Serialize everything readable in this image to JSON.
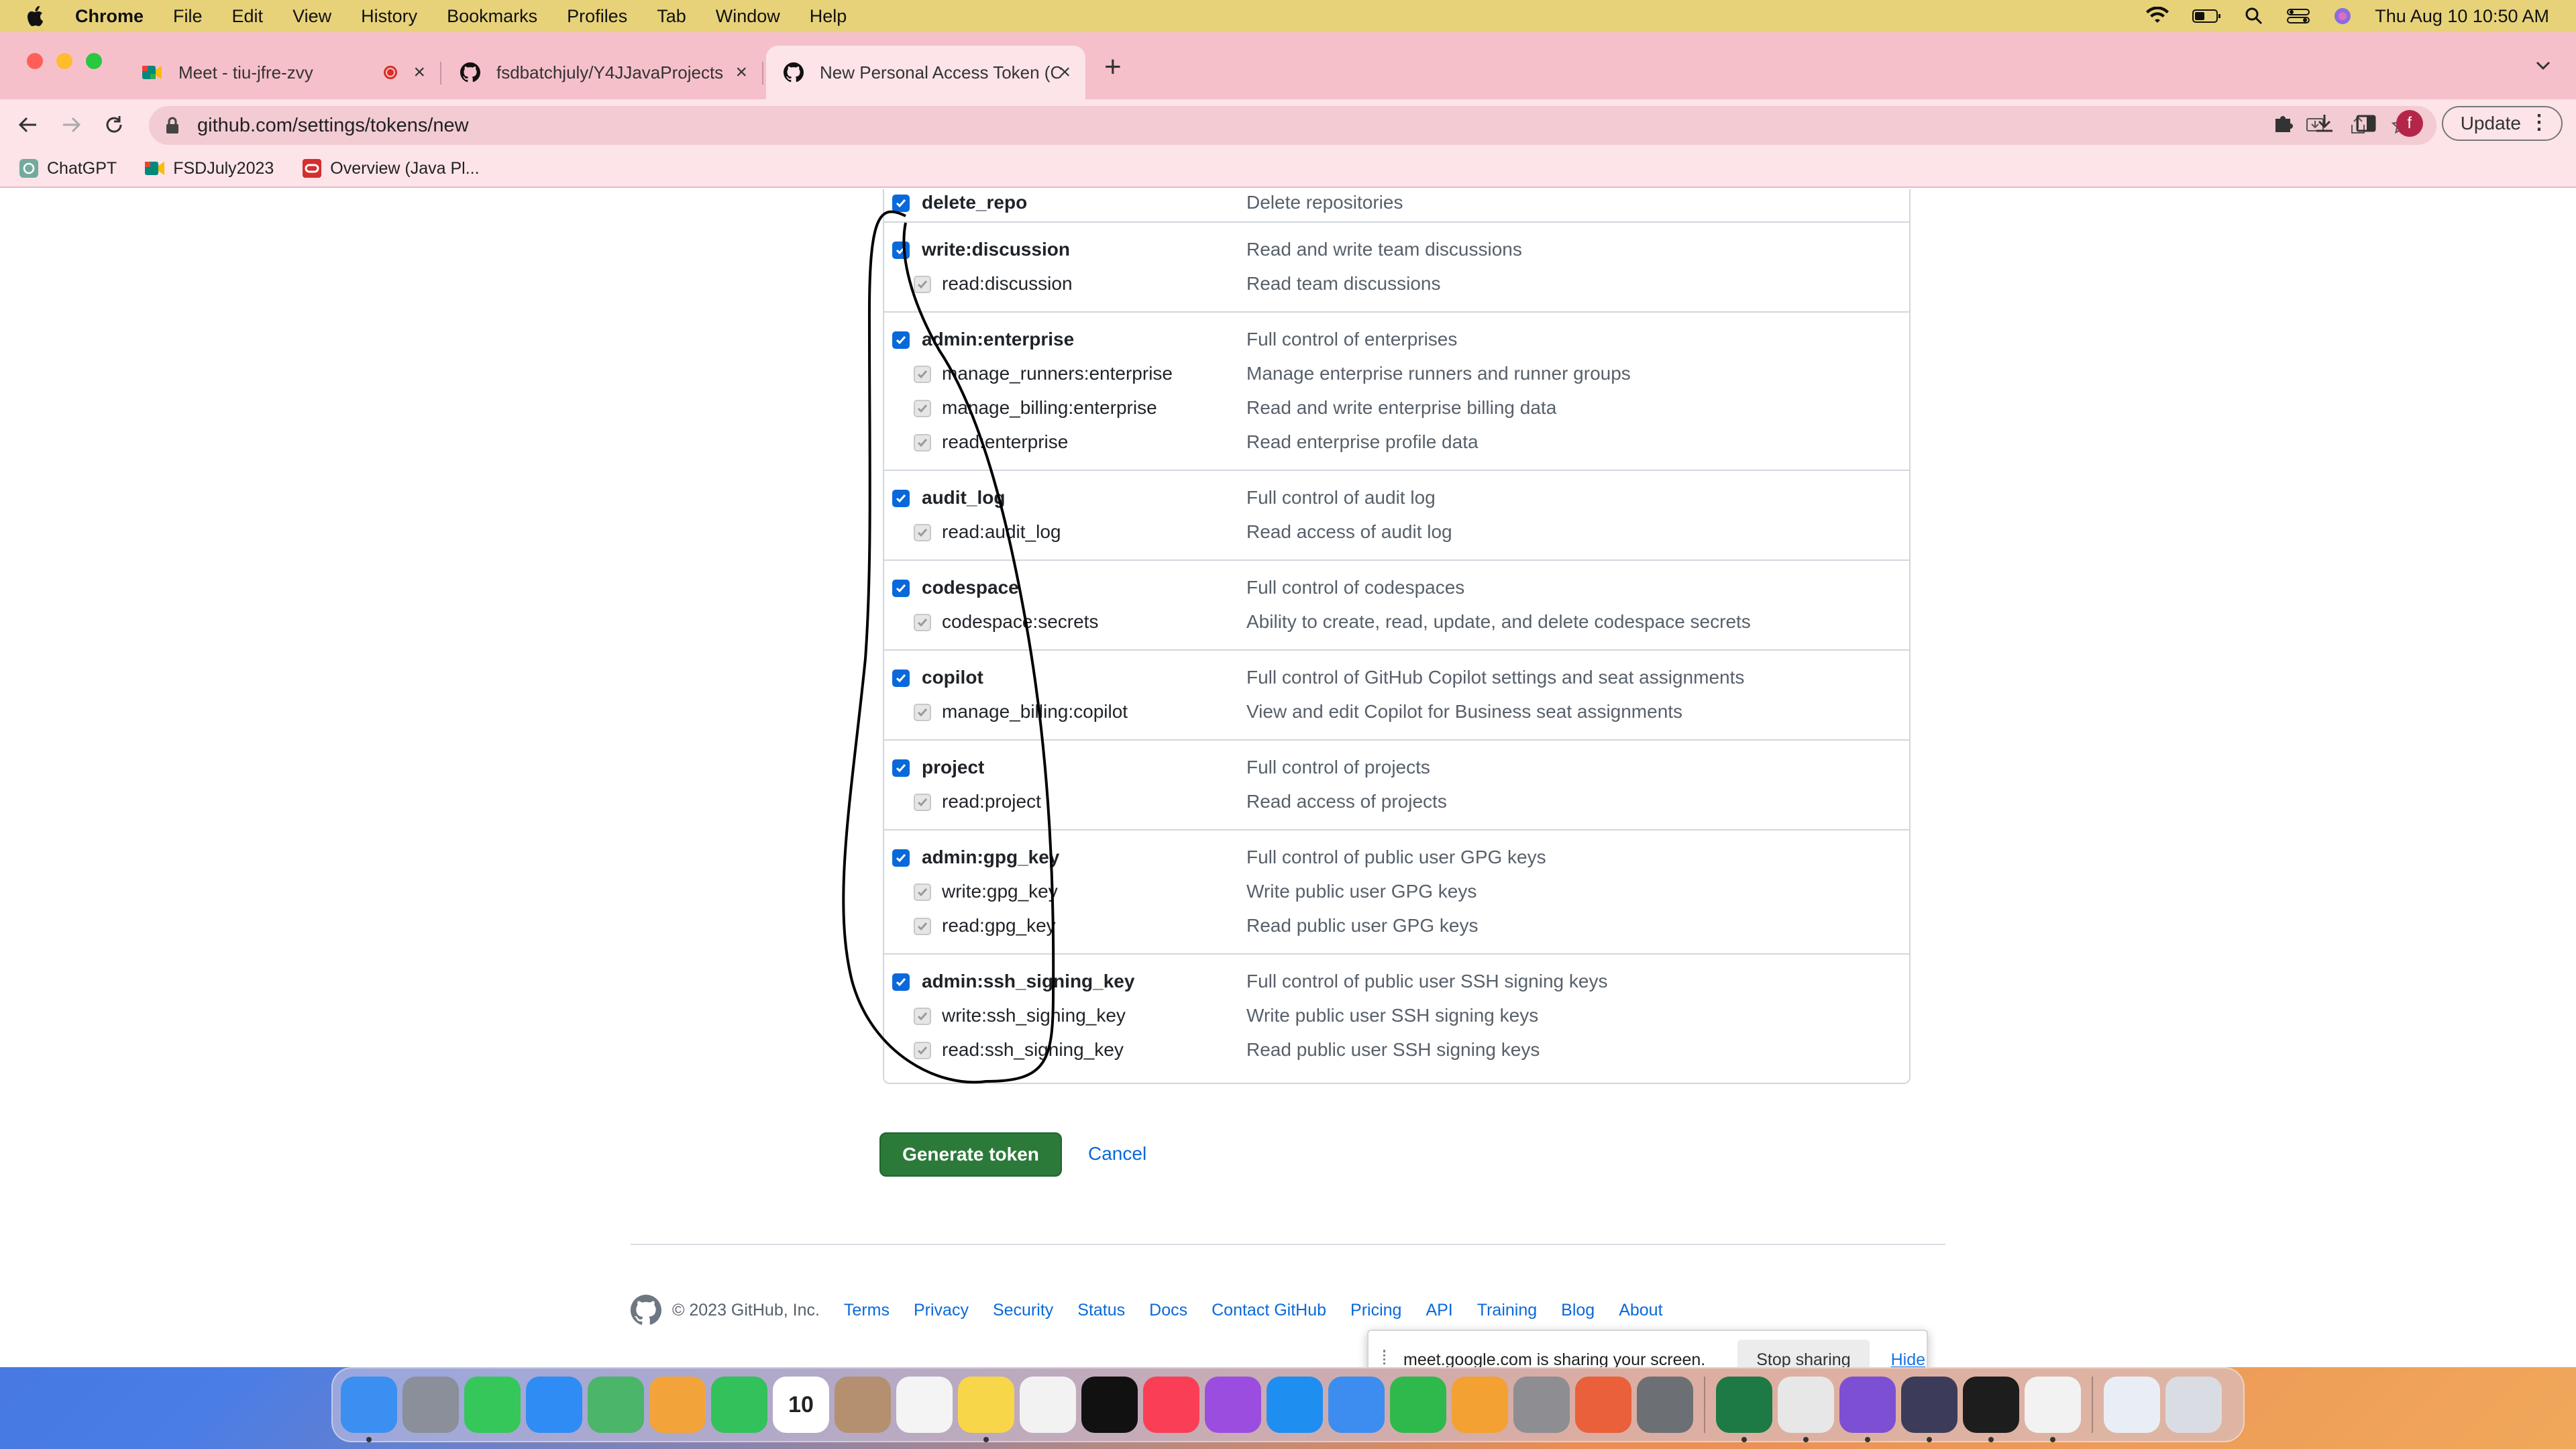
{
  "menubar": {
    "items": [
      "Chrome",
      "File",
      "Edit",
      "View",
      "History",
      "Bookmarks",
      "Profiles",
      "Tab",
      "Window",
      "Help"
    ],
    "datetime": "Thu Aug 10  10:50 AM"
  },
  "tabs": [
    {
      "title": "Meet - tiu-jfre-zvy"
    },
    {
      "title": "fsdbatchjuly/Y4JJavaProjects"
    },
    {
      "title": "New Personal Access Token (C"
    }
  ],
  "address": {
    "url": "github.com/settings/tokens/new"
  },
  "toolbar": {
    "update_label": "Update",
    "avatar_letter": "f"
  },
  "bookmarks": [
    {
      "label": "ChatGPT"
    },
    {
      "label": "FSDJuly2023"
    },
    {
      "label": "Overview (Java Pl..."
    }
  ],
  "scopes": [
    {
      "rows": [
        {
          "name": "delete_repo",
          "desc": "Delete repositories"
        }
      ]
    },
    {
      "rows": [
        {
          "name": "write:discussion",
          "desc": "Read and write team discussions"
        },
        {
          "name": "read:discussion",
          "desc": "Read team discussions",
          "sub": true
        }
      ]
    },
    {
      "rows": [
        {
          "name": "admin:enterprise",
          "desc": "Full control of enterprises"
        },
        {
          "name": "manage_runners:enterprise",
          "desc": "Manage enterprise runners and runner groups",
          "sub": true
        },
        {
          "name": "manage_billing:enterprise",
          "desc": "Read and write enterprise billing data",
          "sub": true
        },
        {
          "name": "read:enterprise",
          "desc": "Read enterprise profile data",
          "sub": true
        }
      ]
    },
    {
      "rows": [
        {
          "name": "audit_log",
          "desc": "Full control of audit log"
        },
        {
          "name": "read:audit_log",
          "desc": "Read access of audit log",
          "sub": true
        }
      ]
    },
    {
      "rows": [
        {
          "name": "codespace",
          "desc": "Full control of codespaces"
        },
        {
          "name": "codespace:secrets",
          "desc": "Ability to create, read, update, and delete codespace secrets",
          "sub": true
        }
      ]
    },
    {
      "rows": [
        {
          "name": "copilot",
          "desc": "Full control of GitHub Copilot settings and seat assignments"
        },
        {
          "name": "manage_billing:copilot",
          "desc": "View and edit Copilot for Business seat assignments",
          "sub": true
        }
      ]
    },
    {
      "rows": [
        {
          "name": "project",
          "desc": "Full control of projects"
        },
        {
          "name": "read:project",
          "desc": "Read access of projects",
          "sub": true
        }
      ]
    },
    {
      "rows": [
        {
          "name": "admin:gpg_key",
          "desc": "Full control of public user GPG keys"
        },
        {
          "name": "write:gpg_key",
          "desc": "Write public user GPG keys",
          "sub": true
        },
        {
          "name": "read:gpg_key",
          "desc": "Read public user GPG keys",
          "sub": true
        }
      ]
    },
    {
      "rows": [
        {
          "name": "admin:ssh_signing_key",
          "desc": "Full control of public user SSH signing keys"
        },
        {
          "name": "write:ssh_signing_key",
          "desc": "Write public user SSH signing keys",
          "sub": true
        },
        {
          "name": "read:ssh_signing_key",
          "desc": "Read public user SSH signing keys",
          "sub": true
        }
      ]
    }
  ],
  "actions": {
    "generate": "Generate token",
    "cancel": "Cancel"
  },
  "footer": {
    "copyright": "© 2023 GitHub, Inc.",
    "links": [
      "Terms",
      "Privacy",
      "Security",
      "Status",
      "Docs",
      "Contact GitHub",
      "Pricing",
      "API",
      "Training",
      "Blog",
      "About"
    ]
  },
  "sharebar": {
    "text": "meet.google.com is sharing your screen.",
    "stop": "Stop sharing",
    "hide": "Hide"
  },
  "dock": {
    "apps": [
      {
        "name": "finder",
        "color": "#3b8ff0",
        "running": true
      },
      {
        "name": "launchpad",
        "color": "#8a8f99"
      },
      {
        "name": "messages",
        "color": "#35c759"
      },
      {
        "name": "mail",
        "color": "#2f8cf4"
      },
      {
        "name": "maps",
        "color": "#4bb56a"
      },
      {
        "name": "photos",
        "color": "#f2a43a"
      },
      {
        "name": "facetime",
        "color": "#32c15a"
      },
      {
        "name": "calendar",
        "color": "#ffffff",
        "label": "10"
      },
      {
        "name": "contacts",
        "color": "#b49070"
      },
      {
        "name": "reminders",
        "color": "#f4f4f4"
      },
      {
        "name": "notes",
        "color": "#f7d64a",
        "running": true
      },
      {
        "name": "freeform",
        "color": "#f2f2f2"
      },
      {
        "name": "tv",
        "color": "#111111"
      },
      {
        "name": "music",
        "color": "#fa3e55"
      },
      {
        "name": "podcasts",
        "color": "#9b4de0"
      },
      {
        "name": "app-store",
        "color": "#1f8ef1"
      },
      {
        "name": "keynote",
        "color": "#3d8df0"
      },
      {
        "name": "numbers",
        "color": "#2fb94d"
      },
      {
        "name": "pages",
        "color": "#f3a132"
      },
      {
        "name": "system-settings",
        "color": "#8d8d92"
      },
      {
        "name": "firefox",
        "color": "#e9603a"
      },
      {
        "name": "image-capture",
        "color": "#6c6f73"
      },
      {
        "name": "excel",
        "color": "#1d7a45",
        "running": true
      },
      {
        "name": "chrome",
        "color": "#e7e7e7",
        "running": true
      },
      {
        "name": "github-desktop",
        "color": "#7d50d3",
        "running": true
      },
      {
        "name": "eclipse",
        "color": "#3c3c5a",
        "running": true
      },
      {
        "name": "terminal",
        "color": "#1d1d1d",
        "running": true
      },
      {
        "name": "textedit",
        "color": "#f2f2f2",
        "running": true
      },
      {
        "name": "downloads-stack",
        "color": "#e9eef6"
      },
      {
        "name": "trash",
        "color": "#d9dde3"
      }
    ]
  }
}
